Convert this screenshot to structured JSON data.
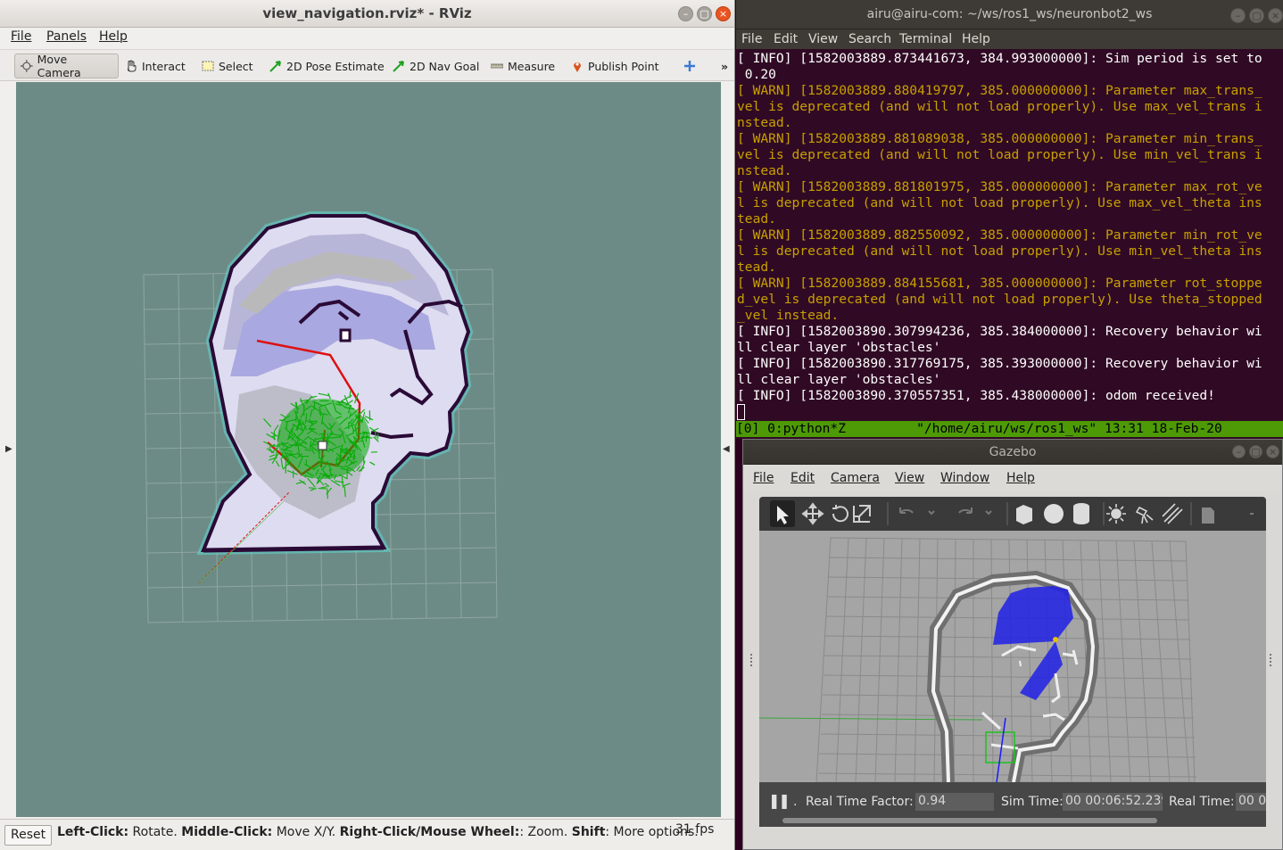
{
  "rviz": {
    "title": "view_navigation.rviz* - RViz",
    "menu": [
      "File",
      "Panels",
      "Help"
    ],
    "tools": [
      {
        "label": "Move Camera",
        "icon": "move-camera-icon"
      },
      {
        "label": "Interact",
        "icon": "hand-icon"
      },
      {
        "label": "Select",
        "icon": "select-icon"
      },
      {
        "label": "2D Pose Estimate",
        "icon": "green-arrow-icon"
      },
      {
        "label": "2D Nav Goal",
        "icon": "green-arrow-icon"
      },
      {
        "label": "Measure",
        "icon": "ruler-icon"
      },
      {
        "label": "Publish Point",
        "icon": "pin-icon"
      }
    ],
    "overflow_label": "»",
    "status": {
      "reset_label": "Reset",
      "help_parts": [
        {
          "bold": "Left-Click:",
          "text": " Rotate. "
        },
        {
          "bold": "Middle-Click:",
          "text": " Move X/Y. "
        },
        {
          "bold": "Right-Click/Mouse Wheel:",
          "text": ": Zoom. "
        },
        {
          "bold": "Shift",
          "text": ": More options."
        }
      ],
      "fps": "31 fps"
    },
    "colors": {
      "viewport_bg": "#6d8b86",
      "path": "#d11",
      "particles": "#0a0"
    }
  },
  "terminal": {
    "title": "airu@airu-com: ~/ws/ros1_ws/neuronbot2_ws",
    "menu": [
      "File",
      "Edit",
      "View",
      "Search",
      "Terminal",
      "Help"
    ],
    "lines": [
      {
        "level": "info",
        "text": "[ INFO] [1582003889.873441673, 384.993000000]: Sim period is set to"
      },
      {
        "level": "info",
        "text": " 0.20"
      },
      {
        "level": "warn",
        "text": "[ WARN] [1582003889.880419797, 385.000000000]: Parameter max_trans_"
      },
      {
        "level": "warn",
        "text": "vel is deprecated (and will not load properly). Use max_vel_trans i"
      },
      {
        "level": "warn",
        "text": "nstead."
      },
      {
        "level": "warn",
        "text": "[ WARN] [1582003889.881089038, 385.000000000]: Parameter min_trans_"
      },
      {
        "level": "warn",
        "text": "vel is deprecated (and will not load properly). Use min_vel_trans i"
      },
      {
        "level": "warn",
        "text": "nstead."
      },
      {
        "level": "warn",
        "text": "[ WARN] [1582003889.881801975, 385.000000000]: Parameter max_rot_ve"
      },
      {
        "level": "warn",
        "text": "l is deprecated (and will not load properly). Use max_vel_theta ins"
      },
      {
        "level": "warn",
        "text": "tead."
      },
      {
        "level": "warn",
        "text": "[ WARN] [1582003889.882550092, 385.000000000]: Parameter min_rot_ve"
      },
      {
        "level": "warn",
        "text": "l is deprecated (and will not load properly). Use min_vel_theta ins"
      },
      {
        "level": "warn",
        "text": "tead."
      },
      {
        "level": "warn",
        "text": "[ WARN] [1582003889.884155681, 385.000000000]: Parameter rot_stoppe"
      },
      {
        "level": "warn",
        "text": "d_vel is deprecated (and will not load properly). Use theta_stopped"
      },
      {
        "level": "warn",
        "text": "_vel instead."
      },
      {
        "level": "info",
        "text": "[ INFO] [1582003890.307994236, 385.384000000]: Recovery behavior wi"
      },
      {
        "level": "info",
        "text": "ll clear layer 'obstacles'"
      },
      {
        "level": "info",
        "text": "[ INFO] [1582003890.317769175, 385.393000000]: Recovery behavior wi"
      },
      {
        "level": "info",
        "text": "ll clear layer 'obstacles'"
      },
      {
        "level": "info",
        "text": "[ INFO] [1582003890.370557351, 385.438000000]: odom received!"
      }
    ],
    "tmux_status": "[0] 0:python*Z         \"/home/airu/ws/ros1_ws\" 13:31 18-Feb-20"
  },
  "gazebo": {
    "title": "Gazebo",
    "menu": [
      "File",
      "Edit",
      "Camera",
      "View",
      "Window",
      "Help"
    ],
    "tool_icons": [
      "select-arrow-icon",
      "translate-icon",
      "rotate-icon",
      "scale-icon",
      "undo-icon",
      "redo-icon",
      "box-icon",
      "sphere-icon",
      "cylinder-icon",
      "sun-light-icon",
      "spot-light-icon",
      "directional-light-icon",
      "copy-icon"
    ],
    "pause_label": "❚❚",
    "rtf_label": "Real Time Factor:",
    "rtf_value": "0.94",
    "sim_time_label": "Sim Time:",
    "sim_time_value": "00 00:06:52.239",
    "real_time_label": "Real Time:",
    "real_time_value": "00 0"
  }
}
